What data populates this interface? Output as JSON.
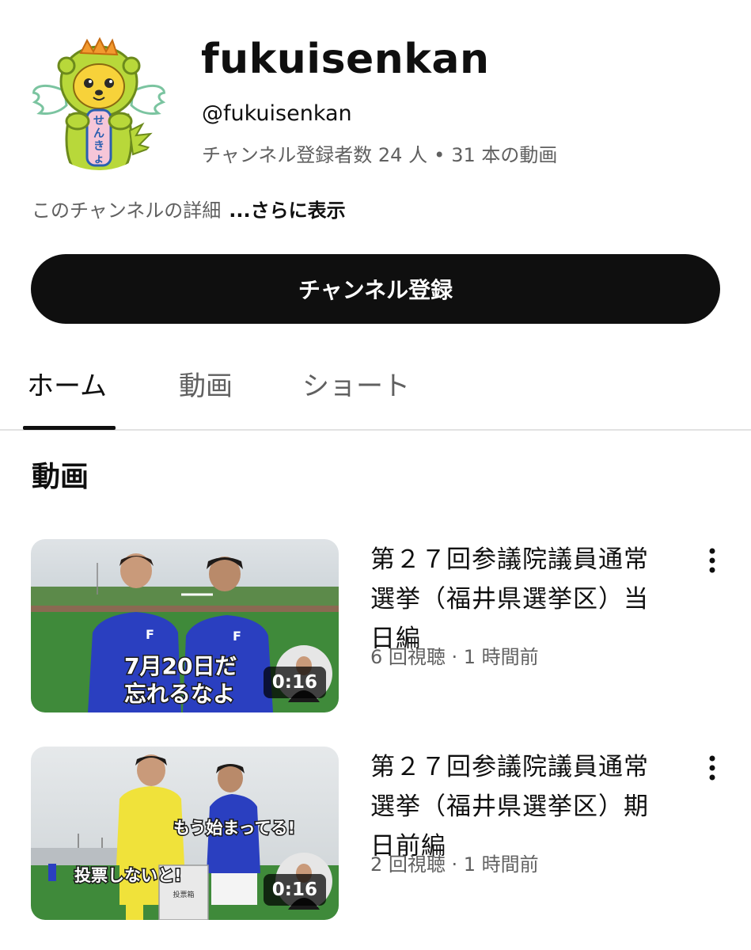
{
  "channel": {
    "name": "fukuisenkan",
    "handle": "@fukuisenkan",
    "subscribers": "チャンネル登録者数 24 人",
    "separator": "•",
    "video_count": "31 本の動画",
    "description": "このチャンネルの詳細",
    "more_label": "...さらに表示",
    "subscribe_label": "チャンネル登録",
    "avatar_text": "せんきょ"
  },
  "tabs": [
    {
      "label": "ホーム",
      "active": true
    },
    {
      "label": "動画",
      "active": false
    },
    {
      "label": "ショート",
      "active": false
    }
  ],
  "section": {
    "title": "動画"
  },
  "videos": [
    {
      "title": "第２７回参議院議員通常選挙（福井県選挙区）当日編",
      "meta": "6 回視聴 · 1 時間前",
      "duration": "0:16",
      "caption_line1": "7月20日だ",
      "caption_line2": "忘れるなよ"
    },
    {
      "title": "第２７回参議院議員通常選挙（福井県選挙区）期日前編",
      "meta": "2 回視聴 · 1 時間前",
      "duration": "0:16",
      "caption_line1": "もう始まってる!",
      "caption_line2": "投票しないと!",
      "ballot_box_label": "投票箱"
    }
  ],
  "colors": {
    "text_primary": "#0f0f0f",
    "text_secondary": "#606060",
    "button_bg": "#0f0f0f",
    "jersey_blue": "#2a3fc0",
    "grass_green": "#3f8a3a"
  }
}
